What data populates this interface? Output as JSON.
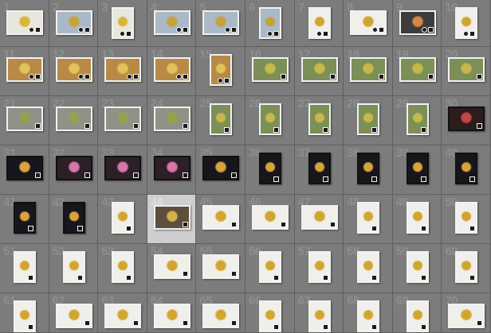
{
  "cells": [
    {
      "n": "1",
      "style": "wide-light"
    },
    {
      "n": "2",
      "style": "wide-blue"
    },
    {
      "n": "3",
      "style": "tall-light"
    },
    {
      "n": "4",
      "style": "wide-blue"
    },
    {
      "n": "5",
      "style": "wide-blue"
    },
    {
      "n": "6",
      "style": "tall-blue"
    },
    {
      "n": "7",
      "style": "tall-white"
    },
    {
      "n": "8",
      "style": "wide-white"
    },
    {
      "n": "9",
      "style": "wide-dark"
    },
    {
      "n": "10",
      "style": "tall-white"
    },
    {
      "n": "11",
      "style": "wide-wood"
    },
    {
      "n": "12",
      "style": "wide-wood"
    },
    {
      "n": "13",
      "style": "wide-wood"
    },
    {
      "n": "14",
      "style": "wide-wood"
    },
    {
      "n": "15",
      "style": "tall-wood"
    },
    {
      "n": "16",
      "style": "wide-green"
    },
    {
      "n": "17",
      "style": "wide-green"
    },
    {
      "n": "18",
      "style": "wide-green"
    },
    {
      "n": "19",
      "style": "wide-green"
    },
    {
      "n": "20",
      "style": "wide-green"
    },
    {
      "n": "21",
      "style": "wide-gray"
    },
    {
      "n": "22",
      "style": "wide-gray"
    },
    {
      "n": "23",
      "style": "wide-gray"
    },
    {
      "n": "24",
      "style": "wide-gray"
    },
    {
      "n": "25",
      "style": "tall-green"
    },
    {
      "n": "26",
      "style": "tall-green"
    },
    {
      "n": "27",
      "style": "tall-green"
    },
    {
      "n": "28",
      "style": "tall-green"
    },
    {
      "n": "29",
      "style": "tall-green"
    },
    {
      "n": "30",
      "style": "wide-darkred"
    },
    {
      "n": "31",
      "style": "wide-night"
    },
    {
      "n": "32",
      "style": "wide-pink"
    },
    {
      "n": "33",
      "style": "wide-pink"
    },
    {
      "n": "34",
      "style": "wide-pink"
    },
    {
      "n": "35",
      "style": "wide-night"
    },
    {
      "n": "36",
      "style": "tall-night"
    },
    {
      "n": "37",
      "style": "tall-night"
    },
    {
      "n": "38",
      "style": "tall-night"
    },
    {
      "n": "39",
      "style": "tall-night"
    },
    {
      "n": "40",
      "style": "tall-night"
    },
    {
      "n": "41",
      "style": "tall-night"
    },
    {
      "n": "42",
      "style": "tall-night"
    },
    {
      "n": "43",
      "style": "tall-white"
    },
    {
      "n": "44",
      "style": "wide-dark-selected"
    },
    {
      "n": "45",
      "style": "wide-white"
    },
    {
      "n": "46",
      "style": "wide-white"
    },
    {
      "n": "47",
      "style": "wide-white"
    },
    {
      "n": "48",
      "style": "tall-white"
    },
    {
      "n": "49",
      "style": "tall-white"
    },
    {
      "n": "50",
      "style": "tall-white"
    },
    {
      "n": "51",
      "style": "tall-white"
    },
    {
      "n": "52",
      "style": "tall-white"
    },
    {
      "n": "53",
      "style": "tall-white"
    },
    {
      "n": "54",
      "style": "wide-white"
    },
    {
      "n": "55",
      "style": "wide-white"
    },
    {
      "n": "56",
      "style": "tall-white"
    },
    {
      "n": "57",
      "style": "tall-white"
    },
    {
      "n": "58",
      "style": "tall-white"
    },
    {
      "n": "59",
      "style": "tall-white"
    },
    {
      "n": "60",
      "style": "tall-white"
    },
    {
      "n": "61",
      "style": "tall-white"
    },
    {
      "n": "62",
      "style": "wide-white"
    },
    {
      "n": "63",
      "style": "wide-white"
    },
    {
      "n": "64",
      "style": "wide-white"
    },
    {
      "n": "65",
      "style": "wide-white"
    },
    {
      "n": "66",
      "style": "tall-white"
    },
    {
      "n": "67",
      "style": "tall-white"
    },
    {
      "n": "68",
      "style": "tall-white"
    },
    {
      "n": "69",
      "style": "tall-white"
    },
    {
      "n": "70",
      "style": "wide-white"
    }
  ],
  "selected_index": 43,
  "colors": {
    "background": "#6e6e6e",
    "cell": "#7c7c7c",
    "cell_selected": "#cfcfcf",
    "number": "#8e8e8e"
  }
}
